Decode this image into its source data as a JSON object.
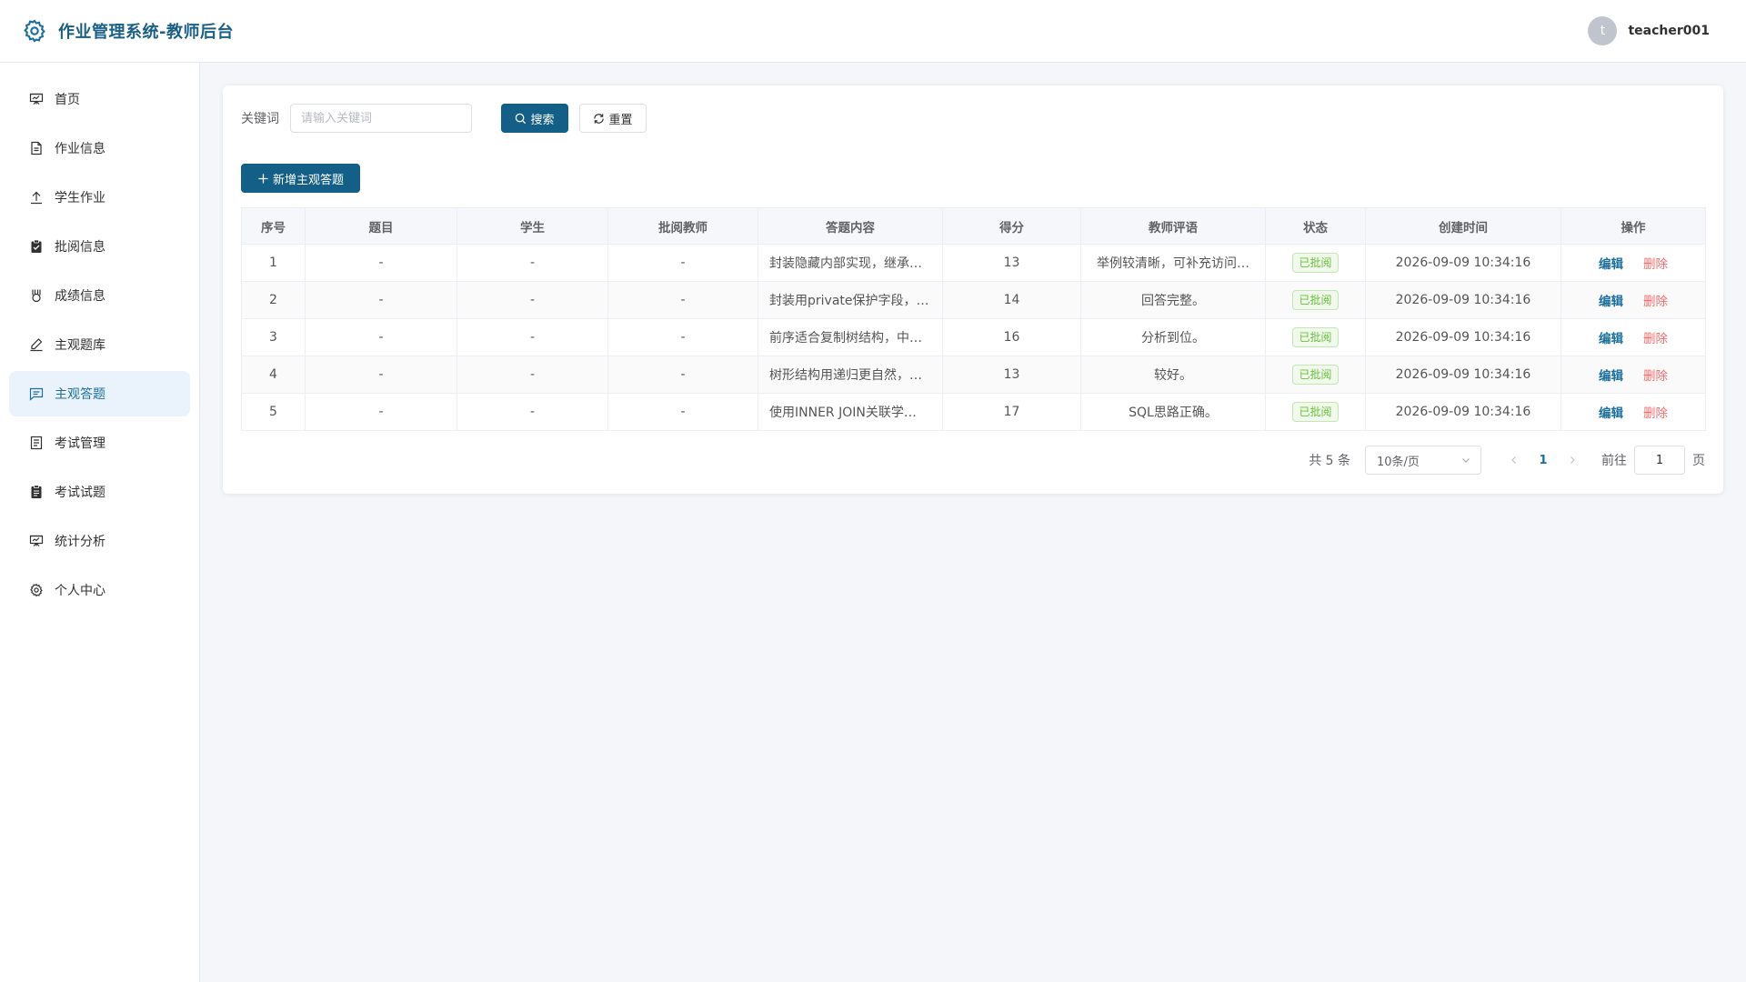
{
  "header": {
    "title": "作业管理系统-教师后台",
    "user": {
      "avatar_letter": "t",
      "username": "teacher001"
    }
  },
  "sidebar": {
    "items": [
      {
        "label": "首页",
        "icon": "presentation-icon",
        "active": false
      },
      {
        "label": "作业信息",
        "icon": "document-icon",
        "active": false
      },
      {
        "label": "学生作业",
        "icon": "upload-icon",
        "active": false
      },
      {
        "label": "批阅信息",
        "icon": "clipboard-check-icon",
        "active": false
      },
      {
        "label": "成绩信息",
        "icon": "medal-icon",
        "active": false
      },
      {
        "label": "主观题库",
        "icon": "edit-pen-icon",
        "active": false
      },
      {
        "label": "主观答题",
        "icon": "chat-square-icon",
        "active": true
      },
      {
        "label": "考试管理",
        "icon": "tickets-icon",
        "active": false
      },
      {
        "label": "考试试题",
        "icon": "notebook-icon",
        "active": false
      },
      {
        "label": "统计分析",
        "icon": "data-board-icon",
        "active": false
      },
      {
        "label": "个人中心",
        "icon": "gear-icon",
        "active": false
      }
    ]
  },
  "toolbar": {
    "keyword_label": "关键词",
    "keyword_placeholder": "请输入关键词",
    "keyword_value": "",
    "search_label": "搜索",
    "reset_label": "重置",
    "add_label": "新增主观答题"
  },
  "table": {
    "columns": [
      "序号",
      "题目",
      "学生",
      "批阅教师",
      "答题内容",
      "得分",
      "教师评语",
      "状态",
      "创建时间",
      "操作"
    ],
    "rows": [
      {
        "index": "1",
        "question": "-",
        "student": "-",
        "teacher": "-",
        "content": "封装隐藏内部实现，继承…",
        "score": "13",
        "comment": "举例较清晰，可补充访问…",
        "status": "已批阅",
        "created": "2026-09-09 10:34:16",
        "edit": "编辑",
        "delete": "删除"
      },
      {
        "index": "2",
        "question": "-",
        "student": "-",
        "teacher": "-",
        "content": "封装用private保护字段，…",
        "score": "14",
        "comment": "回答完整。",
        "status": "已批阅",
        "created": "2026-09-09 10:34:16",
        "edit": "编辑",
        "delete": "删除"
      },
      {
        "index": "3",
        "question": "-",
        "student": "-",
        "teacher": "-",
        "content": "前序适合复制树结构，中…",
        "score": "16",
        "comment": "分析到位。",
        "status": "已批阅",
        "created": "2026-09-09 10:34:16",
        "edit": "编辑",
        "delete": "删除"
      },
      {
        "index": "4",
        "question": "-",
        "student": "-",
        "teacher": "-",
        "content": "树形结构用递归更自然，…",
        "score": "13",
        "comment": "较好。",
        "status": "已批阅",
        "created": "2026-09-09 10:34:16",
        "edit": "编辑",
        "delete": "删除"
      },
      {
        "index": "5",
        "question": "-",
        "student": "-",
        "teacher": "-",
        "content": "使用INNER JOIN关联学…",
        "score": "17",
        "comment": "SQL思路正确。",
        "status": "已批阅",
        "created": "2026-09-09 10:34:16",
        "edit": "编辑",
        "delete": "删除"
      }
    ]
  },
  "pagination": {
    "total_text": "共 5 条",
    "page_size": "10条/页",
    "current_page": "1",
    "goto_label": "前往",
    "goto_value": "1",
    "page_suffix": "页"
  },
  "colors": {
    "brand": "#1a5f86",
    "primary_button": "#135f87",
    "status_green": "#67c23a",
    "danger": "#f56c6c"
  }
}
